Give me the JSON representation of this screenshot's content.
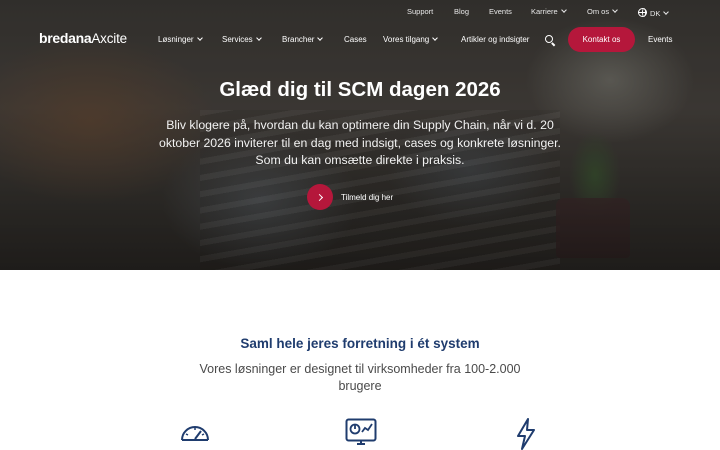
{
  "utility_bar": {
    "support": "Support",
    "blog": "Blog",
    "events": "Events",
    "career": "Karriere",
    "about": "Om os",
    "language": "DK"
  },
  "header": {
    "logo_bold": "bredana",
    "logo_light": "Axcite",
    "nav": {
      "solutions": "Løsninger",
      "services": "Services",
      "industries": "Brancher",
      "cases": "Cases",
      "approach": "Vores tilgang",
      "articles": "Artikler og indsigter"
    },
    "contact_label": "Kontakt os",
    "events_label": "Events"
  },
  "hero": {
    "title": "Glæd dig til SCM dagen 2026",
    "text": "Bliv klogere på, hvordan du kan optimere din Supply Chain, når vi d. 20 oktober 2026 inviterer til en dag med indsigt, cases og konkrete løsninger. Som du kan omsætte direkte i praksis.",
    "cta_label": "Tilmeld dig her"
  },
  "section": {
    "title": "Saml hele jeres forretning i ét system",
    "text": "Vores løsninger er designet til virksomheder fra 100-2.000 brugere"
  },
  "feature_icons": [
    "speedometer-icon",
    "dashboard-chart-icon",
    "lightning-icon"
  ],
  "colors": {
    "accent": "#b5173b",
    "heading": "#1f3c6e",
    "icon": "#1f3c6e"
  }
}
